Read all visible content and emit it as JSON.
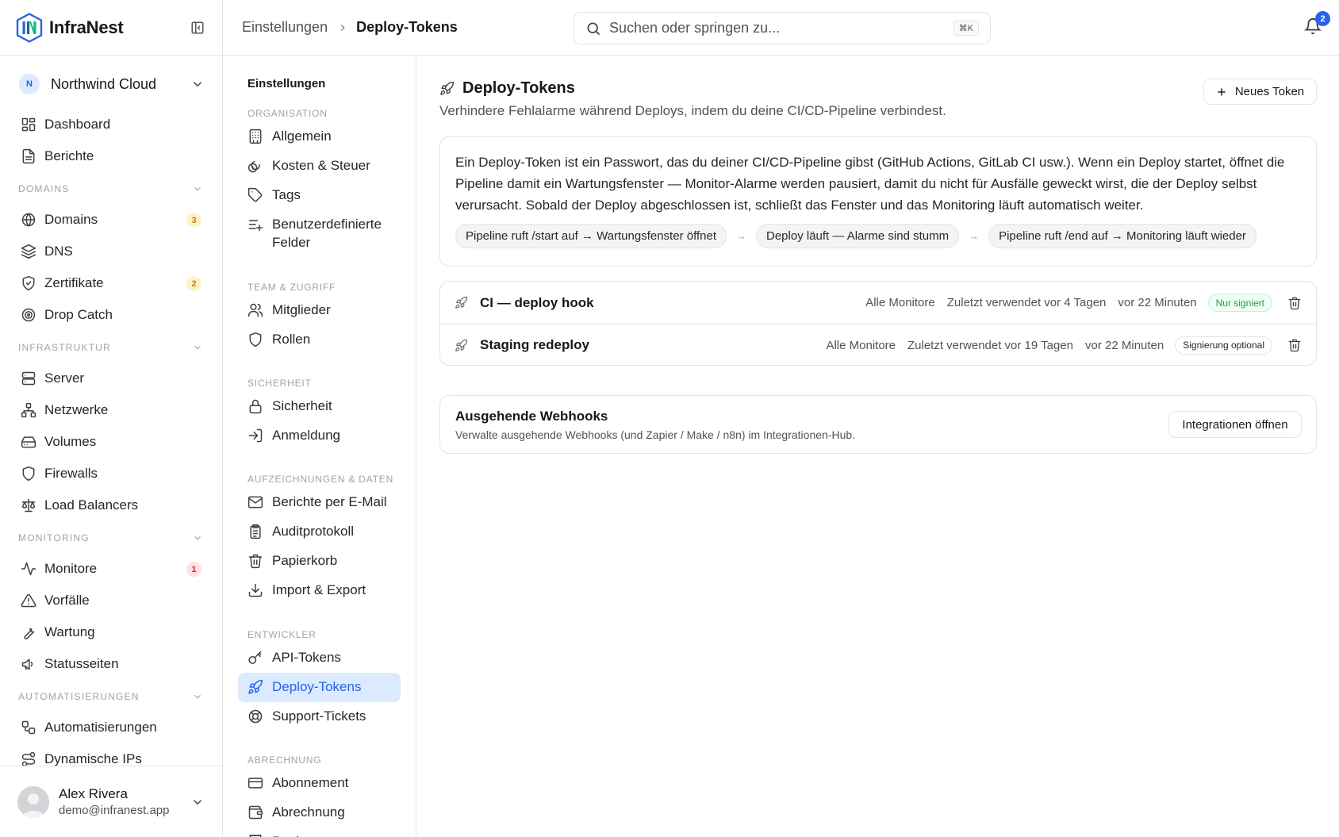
{
  "brand": {
    "name": "InfraNest",
    "logo_mark": "IN"
  },
  "workspace": {
    "initial": "N",
    "name": "Northwind Cloud"
  },
  "sidebar": {
    "top_items": [
      {
        "label": "Dashboard",
        "icon": "dashboard-icon"
      },
      {
        "label": "Berichte",
        "icon": "document-icon"
      }
    ],
    "sections": [
      {
        "title": "DOMAINS",
        "items": [
          {
            "label": "Domains",
            "icon": "globe-icon",
            "badge": "3",
            "badge_color": "amber"
          },
          {
            "label": "DNS",
            "icon": "layers-icon"
          },
          {
            "label": "Zertifikate",
            "icon": "shield-check-icon",
            "badge": "2",
            "badge_color": "amber"
          },
          {
            "label": "Drop Catch",
            "icon": "target-icon"
          }
        ]
      },
      {
        "title": "INFRASTRUKTUR",
        "items": [
          {
            "label": "Server",
            "icon": "server-icon"
          },
          {
            "label": "Netzwerke",
            "icon": "network-icon"
          },
          {
            "label": "Volumes",
            "icon": "hard-drive-icon"
          },
          {
            "label": "Firewalls",
            "icon": "shield-icon"
          },
          {
            "label": "Load Balancers",
            "icon": "scale-icon"
          }
        ]
      },
      {
        "title": "MONITORING",
        "items": [
          {
            "label": "Monitore",
            "icon": "activity-icon",
            "badge": "1",
            "badge_color": "red"
          },
          {
            "label": "Vorfälle",
            "icon": "alert-triangle-icon"
          },
          {
            "label": "Wartung",
            "icon": "wrench-icon"
          },
          {
            "label": "Statusseiten",
            "icon": "megaphone-icon"
          }
        ]
      },
      {
        "title": "AUTOMATISIERUNGEN",
        "items": [
          {
            "label": "Automatisierungen",
            "icon": "workflow-icon"
          },
          {
            "label": "Dynamische IPs",
            "icon": "route-icon"
          }
        ]
      }
    ]
  },
  "user": {
    "name": "Alex Rivera",
    "email": "demo@infranest.app"
  },
  "header": {
    "breadcrumb": [
      "Einstellungen",
      "Deploy-Tokens"
    ],
    "search_placeholder": "Suchen oder springen zu...",
    "search_shortcut": "⌘K",
    "notifications_count": "2"
  },
  "settings_nav": {
    "title": "Einstellungen",
    "groups": [
      {
        "title": "ORGANISATION",
        "items": [
          {
            "label": "Allgemein",
            "icon": "building-icon"
          },
          {
            "label": "Kosten & Steuer",
            "icon": "coins-icon"
          },
          {
            "label": "Tags",
            "icon": "tag-icon"
          },
          {
            "label": "Benutzerdefinierte Felder",
            "icon": "list-plus-icon"
          }
        ]
      },
      {
        "title": "TEAM & ZUGRIFF",
        "items": [
          {
            "label": "Mitglieder",
            "icon": "users-icon"
          },
          {
            "label": "Rollen",
            "icon": "shield-icon"
          }
        ]
      },
      {
        "title": "SICHERHEIT",
        "items": [
          {
            "label": "Sicherheit",
            "icon": "lock-icon"
          },
          {
            "label": "Anmeldung",
            "icon": "log-in-icon"
          }
        ]
      },
      {
        "title": "AUFZEICHNUNGEN & DATEN",
        "items": [
          {
            "label": "Berichte per E-Mail",
            "icon": "mail-icon"
          },
          {
            "label": "Auditprotokoll",
            "icon": "clipboard-icon"
          },
          {
            "label": "Papierkorb",
            "icon": "trash-icon"
          },
          {
            "label": "Import & Export",
            "icon": "download-icon"
          }
        ]
      },
      {
        "title": "ENTWICKLER",
        "items": [
          {
            "label": "API-Tokens",
            "icon": "key-icon"
          },
          {
            "label": "Deploy-Tokens",
            "icon": "rocket-icon",
            "active": true
          },
          {
            "label": "Support-Tickets",
            "icon": "lifebuoy-icon"
          }
        ]
      },
      {
        "title": "ABRECHNUNG",
        "items": [
          {
            "label": "Abonnement",
            "icon": "credit-card-icon"
          },
          {
            "label": "Abrechnung",
            "icon": "wallet-icon"
          },
          {
            "label": "Rechnungen",
            "icon": "receipt-icon"
          }
        ]
      }
    ]
  },
  "page": {
    "title": "Deploy-Tokens",
    "subtitle": "Verhindere Fehlalarme während Deploys, indem du deine CI/CD-Pipeline verbindest.",
    "new_token_label": "Neues Token",
    "info_text": "Ein Deploy-Token ist ein Passwort, das du deiner CI/CD-Pipeline gibst (GitHub Actions, GitLab CI usw.). Wenn ein Deploy startet, öffnet die Pipeline damit ein Wartungsfenster — Monitor-Alarme werden pausiert, damit du nicht für Ausfälle geweckt wirst, die der Deploy selbst verursacht. Sobald der Deploy abgeschlossen ist, schließt das Fenster und das Monitoring läuft automatisch weiter.",
    "flow": [
      "Pipeline ruft /start auf → Wartungsfenster öffnet",
      "Deploy läuft — Alarme sind stumm",
      "Pipeline ruft /end auf → Monitoring läuft wieder"
    ],
    "tokens": [
      {
        "name": "CI — deploy hook",
        "scope": "Alle Monitore",
        "last_used": "Zuletzt verwendet vor 4 Tagen",
        "created": "vor 22 Minuten",
        "signing": "Nur signiert",
        "signing_style": "green"
      },
      {
        "name": "Staging redeploy",
        "scope": "Alle Monitore",
        "last_used": "Zuletzt verwendet vor 19 Tagen",
        "created": "vor 22 Minuten",
        "signing": "Signierung optional",
        "signing_style": "gray"
      }
    ],
    "webhooks": {
      "title": "Ausgehende Webhooks",
      "description": "Verwalte ausgehende Webhooks (und Zapier / Make / n8n) im Integrationen-Hub.",
      "button_label": "Integrationen öffnen"
    }
  },
  "colors": {
    "accent": "#2563eb",
    "active_bg": "#dbeafe",
    "badge_amber": "#d97706",
    "badge_red": "#dc2626",
    "tag_green": "#16a34a"
  }
}
